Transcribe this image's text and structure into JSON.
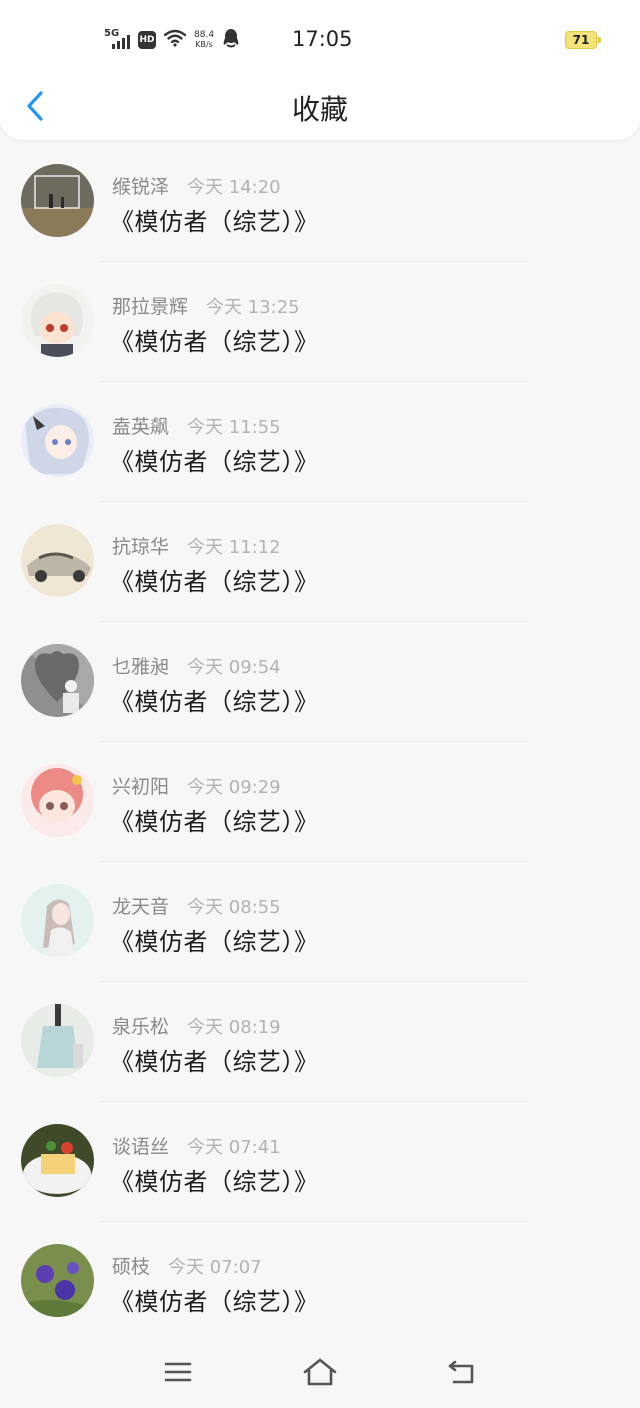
{
  "status_bar": {
    "network": "5G",
    "hd": "HD",
    "speed_value": "88.4",
    "speed_unit": "KB/s",
    "time": "17:05",
    "battery": "71",
    "icons": [
      "signal-icon",
      "wifi-icon",
      "qq-icon"
    ]
  },
  "header": {
    "title": "收藏",
    "back_icon": "chevron-left-icon",
    "accent_color": "#2196f3"
  },
  "items": [
    {
      "user": "缑锐泽",
      "time": "今天 14:20",
      "title": "《模仿者（综艺）》"
    },
    {
      "user": "那拉景辉",
      "time": "今天 13:25",
      "title": "《模仿者（综艺）》"
    },
    {
      "user": "盍英飙",
      "time": "今天 11:55",
      "title": "《模仿者（综艺）》"
    },
    {
      "user": "抗琼华",
      "time": "今天 11:12",
      "title": "《模仿者（综艺）》"
    },
    {
      "user": "乜雅昶",
      "time": "今天 09:54",
      "title": "《模仿者（综艺）》"
    },
    {
      "user": "兴初阳",
      "time": "今天 09:29",
      "title": "《模仿者（综艺）》"
    },
    {
      "user": "龙天音",
      "time": "今天 08:55",
      "title": "《模仿者（综艺）》"
    },
    {
      "user": "泉乐松",
      "time": "今天 08:19",
      "title": "《模仿者（综艺）》"
    },
    {
      "user": "谈语丝",
      "time": "今天 07:41",
      "title": "《模仿者（综艺）》"
    },
    {
      "user": "硕枝",
      "time": "今天 07:07",
      "title": "《模仿者（综艺）》"
    }
  ],
  "nav_bar": {
    "icons": [
      "menu-icon",
      "home-icon",
      "back-icon"
    ]
  }
}
